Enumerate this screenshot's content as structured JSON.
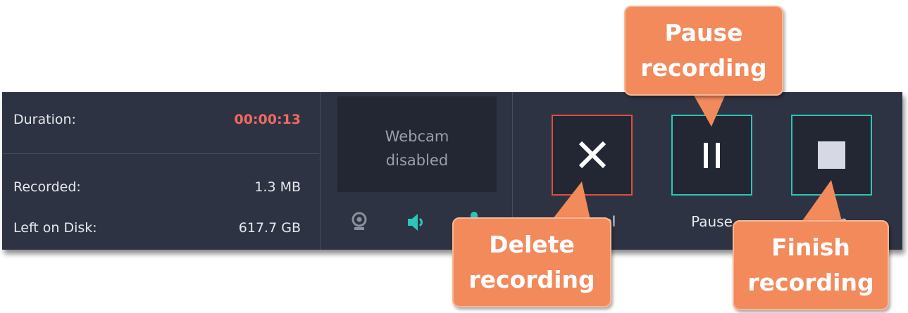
{
  "info": {
    "duration_label": "Duration:",
    "duration_value": "00:00:13",
    "recorded_label": "Recorded:",
    "recorded_value": "1.3 MB",
    "disk_label": "Left on Disk:",
    "disk_value": "617.7 GB"
  },
  "webcam": {
    "line1": "Webcam",
    "line2": "disabled"
  },
  "devices": {
    "webcam_icon": "webcam-icon",
    "speaker_icon": "speaker-icon",
    "microphone_icon": "microphone-icon"
  },
  "controls": {
    "cancel_label": "Cancel",
    "pause_label": "Pause",
    "stop_label": "Stop"
  },
  "callouts": {
    "pause_line1": "Pause",
    "pause_line2": "recording",
    "delete_line1": "Delete",
    "delete_line2": "recording",
    "finish_line1": "Finish",
    "finish_line2": "recording"
  },
  "colors": {
    "panel_bg": "#2e3343",
    "duration_red": "#f06a5e",
    "cancel_border": "#d9513f",
    "teal_accent": "#2fc4b7",
    "callout_orange": "#f28a5c"
  }
}
